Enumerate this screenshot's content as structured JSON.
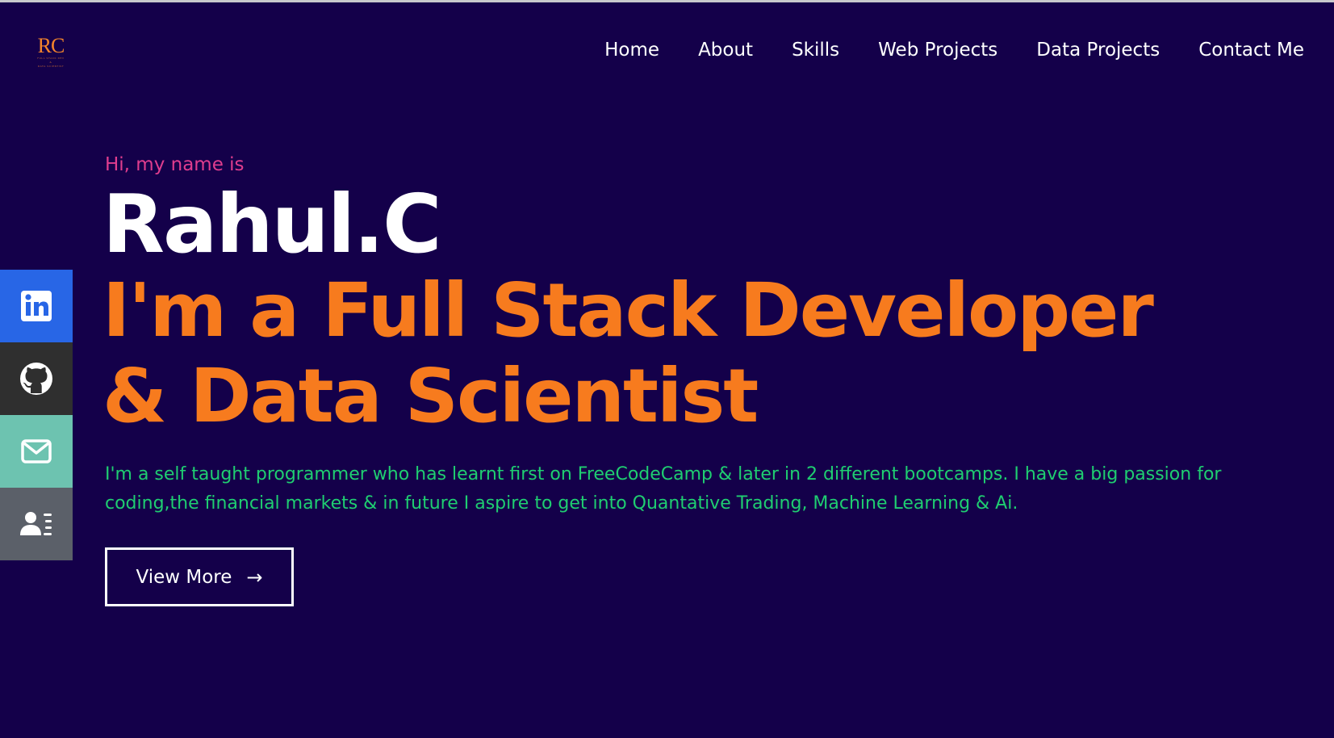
{
  "header": {
    "logo": {
      "mark": "RC",
      "subtitle_lines": [
        "FULL STACK DEV",
        "&",
        "DATA SCIENTIST"
      ],
      "color": "#f2832c"
    },
    "nav": [
      {
        "label": "Home"
      },
      {
        "label": "About"
      },
      {
        "label": "Skills"
      },
      {
        "label": "Web Projects"
      },
      {
        "label": "Data Projects"
      },
      {
        "label": "Contact Me"
      }
    ]
  },
  "social": [
    {
      "icon": "linkedin-icon",
      "color": "#2866e6"
    },
    {
      "icon": "github-icon",
      "color": "#2f2f2f"
    },
    {
      "icon": "mail-icon",
      "color": "#6dc3b0"
    },
    {
      "icon": "resume-icon",
      "color": "#5b6069"
    }
  ],
  "hero": {
    "greeting": "Hi, my name is",
    "name": "Rahul.C",
    "role_lines": [
      "I'm a Full Stack Developer",
      "& Data Scientist"
    ],
    "bio_lines": [
      "I'm a self taught programmer who has learnt first on FreeCodeCamp & later in 2 different bootcamps. I have a big passion for",
      "coding,the financial markets & in future I aspire to get into Quantative Trading, Machine Learning & Ai."
    ],
    "cta_label": "View More",
    "cta_arrow": "→"
  },
  "colors": {
    "background": "#14004a",
    "greeting": "#e03d8e",
    "name": "#ffffff",
    "role": "#f77b1e",
    "bio": "#1fce71"
  }
}
